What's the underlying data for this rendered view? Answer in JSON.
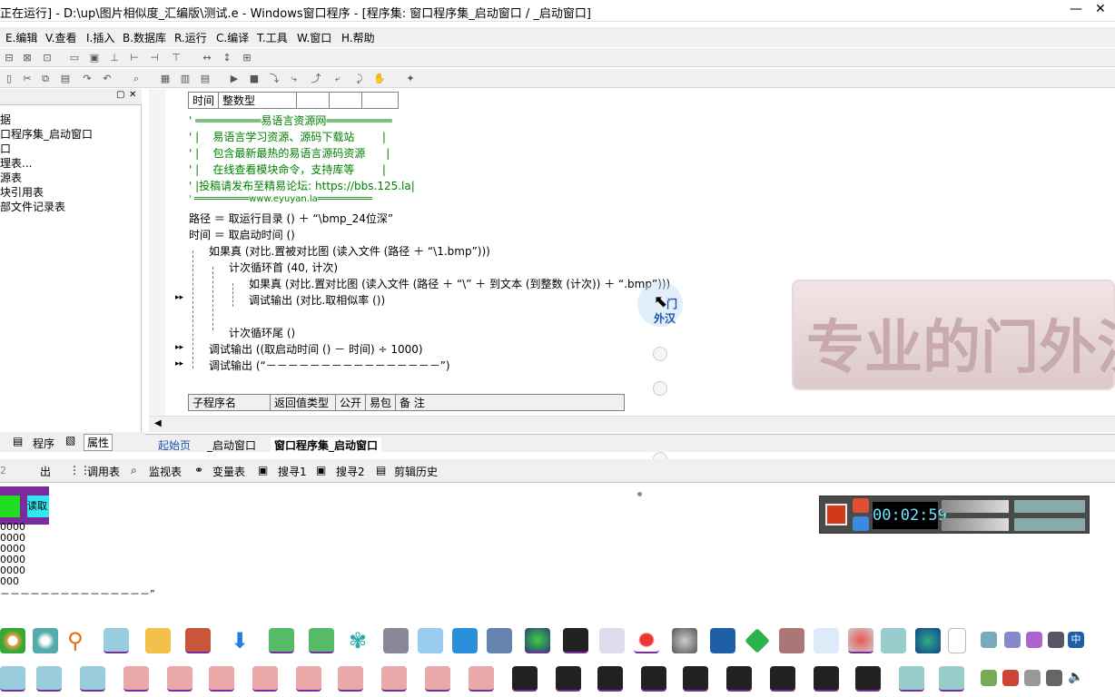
{
  "window": {
    "title": "正在运行] - D:\\up\\图片相似度_汇编版\\测试.e - Windows窗口程序 - [程序集: 窗口程序集_启动窗口 / _启动窗口]",
    "minimize": "—",
    "close": "✕"
  },
  "menu": [
    "E.编辑",
    "V.查看",
    "I.插入",
    "B.数据库",
    "R.运行",
    "C.编译",
    "T.工具",
    "W.窗口",
    "H.帮助"
  ],
  "left_panel": {
    "tree": [
      "据",
      "口程序集_启动窗口",
      "口",
      "理表...",
      "源表",
      "块引用表",
      "部文件记录表"
    ],
    "tabs": [
      "程序",
      "属性"
    ]
  },
  "editor": {
    "var_table": {
      "col1": "时间",
      "col2": "整数型"
    },
    "banner": [
      "' ══════════易语言资源网══════════",
      "' |    易语言学习资源、源码下载站        |",
      "' |    包含最新最热的易语言源码资源      |",
      "' |    在线查看模块命令，支持库等        |",
      "' |投稿请发布至精易论坛: https://bbs.125.la|",
      "' ══════════www.eyuyan.la══════════"
    ],
    "code": [
      "路径 ＝ 取运行目录 () ＋ “\\bmp_24位深”",
      "时间 ＝ 取启动时间 ()",
      "如果真 (对比.置被对比图 (读入文件 (路径 ＋ “\\1.bmp”)))",
      "计次循环首 (40, 计次)",
      "如果真 (对比.置对比图 (读入文件 (路径 ＋ “\\” ＋ 到文本 (到整数 (计次)) ＋ “.bmp”)))",
      "调试输出 (对比.取相似率 ())",
      "计次循环尾 ()",
      "调试输出 ((取启动时间 () － 时间) ÷ 1000)",
      "调试输出 (“－－－－－－－－－－－－－－－－”)"
    ],
    "sub_table": [
      "子程序名",
      "返回值类型",
      "公开",
      "易包",
      "备 注"
    ],
    "cursor_text": [
      "门",
      "外汉"
    ]
  },
  "doc_tabs": [
    "起始页",
    "_启动窗口",
    "窗口程序集_启动窗口"
  ],
  "bottom_tabs": [
    "出",
    "调用表",
    "监视表",
    "变量表",
    "搜寻1",
    "搜寻2",
    "剪辑历史"
  ],
  "output": {
    "field_value": "2",
    "button_green": "",
    "button_read": "读取",
    "lines": [
      "0000",
      "0000",
      "0000",
      "0000",
      "0000",
      "000",
      "－－－－－－－－－－－－－－－”"
    ]
  },
  "watermark": "专业的门外汉",
  "recorder": {
    "timer": "00:02:59"
  },
  "colors": {
    "accent_purple": "#7a2c9c",
    "green_button": "#22dd22",
    "cyan_button": "#33e6f0"
  }
}
